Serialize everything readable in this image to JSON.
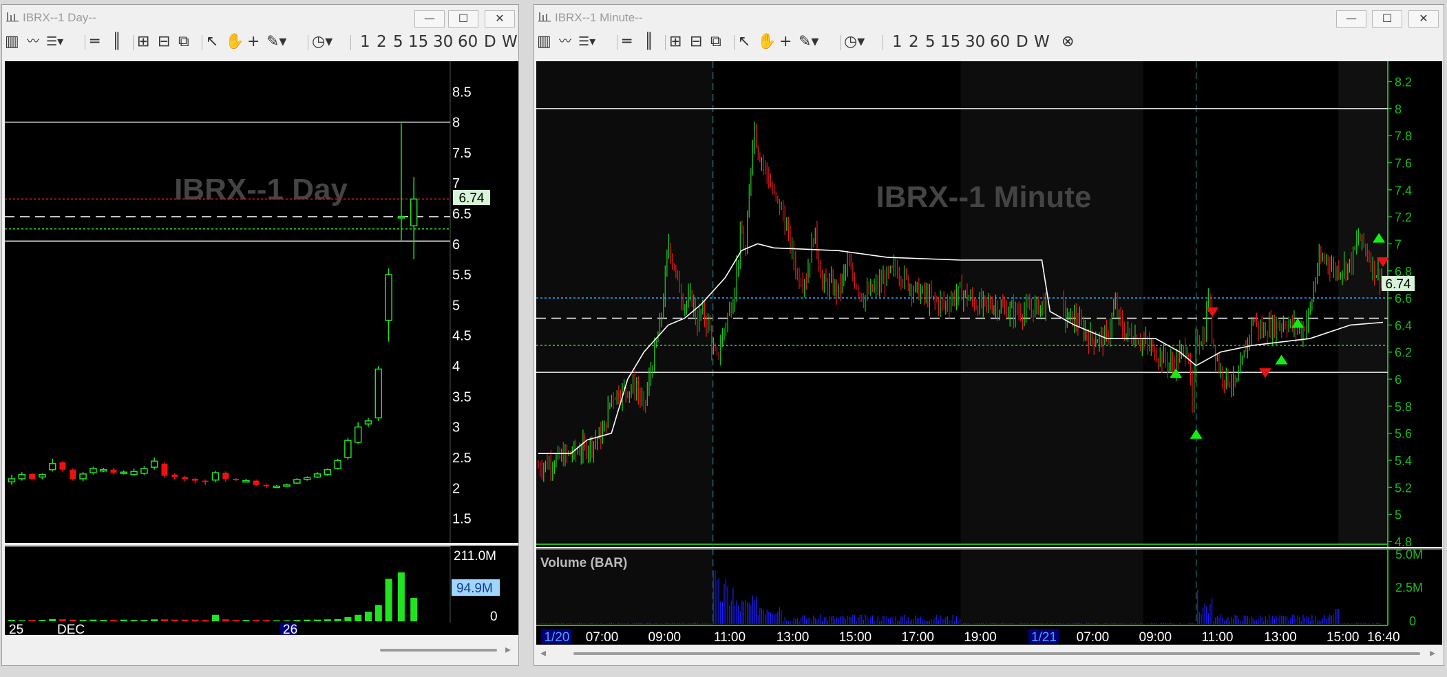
{
  "windows": {
    "day": {
      "title": "IBRX--1 Day--",
      "watermark": "IBRX--1 Day",
      "price_label": "6.74",
      "volume_label_top": "211.0M",
      "volume_label_current": "94.9M",
      "volume_label_zero": "0",
      "date_labels": [
        "25",
        "DEC",
        "26"
      ],
      "toolbar_intervals": [
        "1",
        "2",
        "5",
        "15",
        "30",
        "60",
        "D",
        "W"
      ],
      "colors": {
        "up": "#21e221",
        "down": "#ee1111",
        "volume_up": "#1fe41f",
        "volume_down": "#ee1111"
      }
    },
    "minute": {
      "title": "IBRX--1 Minute--",
      "watermark": "IBRX--1 Minute",
      "price_label": "6.74",
      "volume_title": "Volume (BAR)",
      "volume_axis": [
        "5.0M",
        "2.5M",
        "0"
      ],
      "time_labels": [
        "1/20",
        "07:00",
        "09:00",
        "11:00",
        "13:00",
        "15:00",
        "17:00",
        "19:00",
        "1/21",
        "07:00",
        "09:00",
        "11:00",
        "13:00",
        "15:00",
        "16:40"
      ],
      "toolbar_intervals": [
        "1",
        "2",
        "5",
        "15",
        "30",
        "60",
        "D",
        "W"
      ],
      "colors": {
        "axis": "#1db81d",
        "volume": "#1f1fff",
        "vwap": "#ffffff",
        "buy_marker": "#11ee11",
        "sell_marker": "#ee1111"
      }
    }
  },
  "window_controls": {
    "minimize": "—",
    "maximize": "☐",
    "close": "✕"
  },
  "chart_data": [
    {
      "type": "candlestick",
      "title": "IBRX--1 Day",
      "ylim": [
        1.1,
        9.0
      ],
      "yticks": [
        1.5,
        2,
        2.5,
        3,
        3.5,
        4,
        4.5,
        5,
        5.5,
        6,
        6.5,
        7,
        7.5,
        8,
        8.5
      ],
      "candles": [
        {
          "o": 2.1,
          "c": 2.15,
          "h": 2.22,
          "l": 2.05
        },
        {
          "o": 2.15,
          "c": 2.22,
          "h": 2.26,
          "l": 2.12
        },
        {
          "o": 2.23,
          "c": 2.15,
          "h": 2.25,
          "l": 2.12
        },
        {
          "o": 2.18,
          "c": 2.22,
          "h": 2.24,
          "l": 2.14
        },
        {
          "o": 2.3,
          "c": 2.4,
          "h": 2.48,
          "l": 2.27
        },
        {
          "o": 2.42,
          "c": 2.3,
          "h": 2.44,
          "l": 2.27
        },
        {
          "o": 2.3,
          "c": 2.15,
          "h": 2.32,
          "l": 2.12
        },
        {
          "o": 2.15,
          "c": 2.23,
          "h": 2.26,
          "l": 2.11
        },
        {
          "o": 2.25,
          "c": 2.32,
          "h": 2.35,
          "l": 2.22
        },
        {
          "o": 2.3,
          "c": 2.3,
          "h": 2.33,
          "l": 2.26
        },
        {
          "o": 2.3,
          "c": 2.25,
          "h": 2.33,
          "l": 2.22
        },
        {
          "o": 2.26,
          "c": 2.26,
          "h": 2.29,
          "l": 2.22
        },
        {
          "o": 2.22,
          "c": 2.27,
          "h": 2.32,
          "l": 2.2
        },
        {
          "o": 2.24,
          "c": 2.32,
          "h": 2.36,
          "l": 2.21
        },
        {
          "o": 2.34,
          "c": 2.44,
          "h": 2.5,
          "l": 2.3
        },
        {
          "o": 2.4,
          "c": 2.2,
          "h": 2.42,
          "l": 2.17
        },
        {
          "o": 2.22,
          "c": 2.18,
          "h": 2.24,
          "l": 2.13
        },
        {
          "o": 2.18,
          "c": 2.15,
          "h": 2.2,
          "l": 2.1
        },
        {
          "o": 2.15,
          "c": 2.12,
          "h": 2.17,
          "l": 2.08
        },
        {
          "o": 2.12,
          "c": 2.1,
          "h": 2.14,
          "l": 2.05
        },
        {
          "o": 2.13,
          "c": 2.25,
          "h": 2.28,
          "l": 2.1
        },
        {
          "o": 2.25,
          "c": 2.15,
          "h": 2.27,
          "l": 2.1
        },
        {
          "o": 2.15,
          "c": 2.14,
          "h": 2.16,
          "l": 2.11
        },
        {
          "o": 2.12,
          "c": 2.12,
          "h": 2.15,
          "l": 2.09
        },
        {
          "o": 2.12,
          "c": 2.05,
          "h": 2.14,
          "l": 2.03
        },
        {
          "o": 2.05,
          "c": 2.03,
          "h": 2.07,
          "l": 2.0
        },
        {
          "o": 2.03,
          "c": 2.03,
          "h": 2.05,
          "l": 2.01
        },
        {
          "o": 2.04,
          "c": 2.05,
          "h": 2.07,
          "l": 2.02
        },
        {
          "o": 2.08,
          "c": 2.14,
          "h": 2.16,
          "l": 2.06
        },
        {
          "o": 2.14,
          "c": 2.17,
          "h": 2.19,
          "l": 2.12
        },
        {
          "o": 2.18,
          "c": 2.23,
          "h": 2.26,
          "l": 2.16
        },
        {
          "o": 2.22,
          "c": 2.3,
          "h": 2.32,
          "l": 2.2
        },
        {
          "o": 2.32,
          "c": 2.45,
          "h": 2.48,
          "l": 2.3
        },
        {
          "o": 2.5,
          "c": 2.78,
          "h": 2.82,
          "l": 2.46
        },
        {
          "o": 2.75,
          "c": 3.0,
          "h": 3.08,
          "l": 2.72
        },
        {
          "o": 3.05,
          "c": 3.1,
          "h": 3.15,
          "l": 3.0
        },
        {
          "o": 3.15,
          "c": 3.95,
          "h": 4.0,
          "l": 3.1
        },
        {
          "o": 4.75,
          "c": 5.5,
          "h": 5.6,
          "l": 4.4
        },
        {
          "o": 6.45,
          "c": 6.45,
          "h": 7.98,
          "l": 6.05
        },
        {
          "o": 6.3,
          "c": 6.74,
          "h": 7.1,
          "l": 5.75
        }
      ],
      "volume_m": [
        4,
        3,
        4,
        4,
        7,
        6,
        5,
        4,
        5,
        4,
        4,
        5,
        4,
        4,
        6,
        6,
        5,
        5,
        5,
        4,
        20,
        6,
        4,
        4,
        4,
        4,
        3,
        3,
        4,
        5,
        5,
        6,
        7,
        13,
        20,
        30,
        51,
        133,
        153,
        73
      ],
      "volume_ylim": [
        0,
        211
      ],
      "hlines": [
        {
          "y": 8.0,
          "color": "#cfcfcf",
          "style": "solid"
        },
        {
          "y": 6.74,
          "color": "#d42020",
          "style": "dotted"
        },
        {
          "y": 6.45,
          "color": "#e8e8e8",
          "style": "dashed"
        },
        {
          "y": 6.25,
          "color": "#1fe01f",
          "style": "dotted"
        },
        {
          "y": 6.05,
          "color": "#e8e8e8",
          "style": "solid"
        }
      ]
    },
    {
      "type": "candlestick",
      "title": "IBRX--1 Minute",
      "ylim": [
        4.8,
        8.35
      ],
      "yticks": [
        4.8,
        5,
        5.2,
        5.4,
        5.6,
        5.8,
        6,
        6.2,
        6.4,
        6.6,
        6.8,
        7,
        7.2,
        7.4,
        7.6,
        7.8,
        8,
        8.2
      ],
      "price_path": [
        [
          0,
          5.35
        ],
        [
          6,
          5.5
        ],
        [
          8,
          5.6
        ],
        [
          9,
          5.88
        ],
        [
          12,
          5.95
        ],
        [
          13,
          5.78
        ],
        [
          14,
          6.1
        ],
        [
          15,
          6.4
        ],
        [
          15.5,
          6.65
        ],
        [
          16,
          7.02
        ],
        [
          17,
          6.75
        ],
        [
          18,
          6.55
        ],
        [
          19,
          6.6
        ],
        [
          19.5,
          6.4
        ],
        [
          20,
          6.5
        ],
        [
          21,
          6.4
        ],
        [
          21.5,
          6.2
        ],
        [
          22,
          6.15
        ],
        [
          23,
          6.4
        ],
        [
          24,
          6.6
        ],
        [
          25,
          7.1
        ],
        [
          25.5,
          6.9
        ],
        [
          26,
          7.4
        ],
        [
          26.5,
          7.9
        ],
        [
          27,
          7.7
        ],
        [
          28,
          7.55
        ],
        [
          29,
          7.35
        ],
        [
          30,
          7.25
        ],
        [
          31,
          7.0
        ],
        [
          32,
          6.75
        ],
        [
          33,
          6.75
        ],
        [
          34,
          7.1
        ],
        [
          35,
          6.7
        ],
        [
          36,
          6.7
        ],
        [
          37,
          6.65
        ],
        [
          38,
          6.85
        ],
        [
          40,
          6.6
        ],
        [
          42,
          6.7
        ],
        [
          44,
          6.82
        ],
        [
          46,
          6.68
        ],
        [
          48,
          6.6
        ],
        [
          50,
          6.55
        ],
        [
          52,
          6.65
        ],
        [
          54,
          6.55
        ],
        [
          56,
          6.55
        ],
        [
          58,
          6.5
        ],
        [
          60,
          6.5
        ],
        [
          62,
          6.55
        ],
        [
          64,
          6.55
        ],
        [
          65,
          6.45
        ],
        [
          66,
          6.45
        ],
        [
          68,
          6.3
        ],
        [
          70,
          6.3
        ],
        [
          71,
          6.55
        ],
        [
          72,
          6.35
        ],
        [
          74,
          6.3
        ],
        [
          76,
          6.2
        ],
        [
          78,
          6.1
        ],
        [
          80,
          6.25
        ],
        [
          80.5,
          5.75
        ],
        [
          81,
          6.3
        ],
        [
          82,
          6.3
        ],
        [
          82.5,
          6.65
        ],
        [
          83,
          6.3
        ],
        [
          84,
          6.05
        ],
        [
          85,
          6.0
        ],
        [
          86,
          5.95
        ],
        [
          87,
          6.2
        ],
        [
          88,
          6.45
        ],
        [
          89,
          6.35
        ],
        [
          90,
          6.38
        ],
        [
          92,
          6.42
        ],
        [
          94,
          6.35
        ],
        [
          95,
          6.5
        ],
        [
          96,
          6.85
        ],
        [
          97,
          6.9
        ],
        [
          98,
          6.8
        ],
        [
          100,
          6.85
        ],
        [
          101,
          7.05
        ],
        [
          102,
          6.95
        ],
        [
          103,
          6.8
        ],
        [
          104,
          6.74
        ]
      ],
      "vwap_path": [
        [
          0,
          5.45
        ],
        [
          4,
          5.45
        ],
        [
          6,
          5.55
        ],
        [
          9,
          5.6
        ],
        [
          11,
          6.0
        ],
        [
          13,
          6.2
        ],
        [
          16,
          6.4
        ],
        [
          18,
          6.45
        ],
        [
          20,
          6.55
        ],
        [
          23,
          6.75
        ],
        [
          25,
          6.95
        ],
        [
          27,
          7.0
        ],
        [
          29,
          6.97
        ],
        [
          37,
          6.95
        ],
        [
          43,
          6.9
        ],
        [
          52,
          6.88
        ],
        [
          62,
          6.88
        ],
        [
          63,
          6.5
        ],
        [
          66,
          6.4
        ],
        [
          70,
          6.3
        ],
        [
          76,
          6.3
        ],
        [
          79,
          6.2
        ],
        [
          81,
          6.1
        ],
        [
          84,
          6.2
        ],
        [
          88,
          6.25
        ],
        [
          95,
          6.3
        ],
        [
          100,
          6.4
        ],
        [
          104,
          6.42
        ]
      ],
      "xlim": [
        0,
        104
      ],
      "volume_m_max": 5.0,
      "hlines": [
        {
          "y": 8.0,
          "color": "#d8d8d8",
          "style": "solid"
        },
        {
          "y": 6.6,
          "color": "#1aa8ff",
          "style": "dotted"
        },
        {
          "y": 6.45,
          "color": "#e8e8e8",
          "style": "dashed"
        },
        {
          "y": 6.25,
          "color": "#1fe01f",
          "style": "dotted"
        },
        {
          "y": 6.05,
          "color": "#d8d8d8",
          "style": "solid"
        }
      ],
      "buy_markers": [
        [
          78.5,
          6.05
        ],
        [
          81,
          5.6
        ],
        [
          91.5,
          6.15
        ],
        [
          93.5,
          6.42
        ],
        [
          105.5,
          7.05
        ]
      ],
      "sell_markers": [
        [
          83,
          6.5
        ],
        [
          89.5,
          6.05
        ],
        [
          104,
          6.87
        ]
      ]
    }
  ]
}
